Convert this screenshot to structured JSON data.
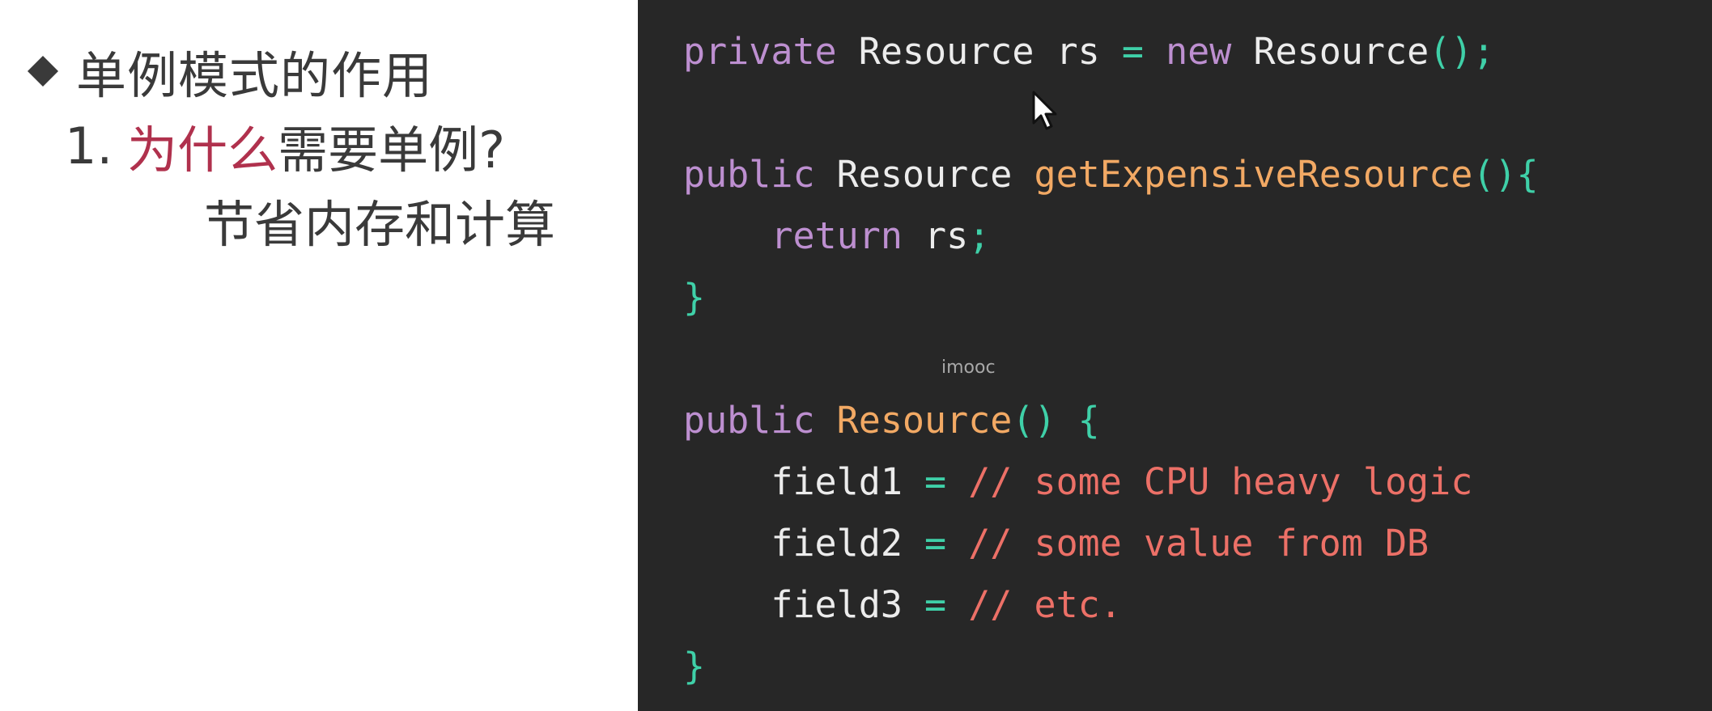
{
  "slide": {
    "heading": "单例模式的作用",
    "question": {
      "number": "1.",
      "highlight": "为什么",
      "rest": "需要单例?"
    },
    "answer": "节省内存和计算"
  },
  "code": {
    "lines": [
      [
        {
          "t": "kw",
          "v": "private "
        },
        {
          "t": "type",
          "v": "Resource "
        },
        {
          "t": "id",
          "v": "rs "
        },
        {
          "t": "op",
          "v": "= "
        },
        {
          "t": "kw",
          "v": "new "
        },
        {
          "t": "type",
          "v": "Resource"
        },
        {
          "t": "op",
          "v": "();"
        }
      ],
      [],
      [
        {
          "t": "kw",
          "v": "public "
        },
        {
          "t": "type",
          "v": "Resource "
        },
        {
          "t": "fn",
          "v": "getExpensiveResource"
        },
        {
          "t": "op",
          "v": "(){"
        }
      ],
      [
        {
          "t": "kw",
          "v": "    return "
        },
        {
          "t": "id",
          "v": "rs"
        },
        {
          "t": "op",
          "v": ";"
        }
      ],
      [
        {
          "t": "op",
          "v": "}"
        }
      ],
      [],
      [
        {
          "t": "kw",
          "v": "public "
        },
        {
          "t": "fn",
          "v": "Resource"
        },
        {
          "t": "op",
          "v": "() {"
        }
      ],
      [
        {
          "t": "id",
          "v": "    field1 "
        },
        {
          "t": "op",
          "v": "= "
        },
        {
          "t": "cm",
          "v": "// some CPU heavy logic"
        }
      ],
      [
        {
          "t": "id",
          "v": "    field2 "
        },
        {
          "t": "op",
          "v": "= "
        },
        {
          "t": "cm",
          "v": "// some value from DB"
        }
      ],
      [
        {
          "t": "id",
          "v": "    field3 "
        },
        {
          "t": "op",
          "v": "= "
        },
        {
          "t": "cm",
          "v": "// etc."
        }
      ],
      [
        {
          "t": "op",
          "v": "}"
        }
      ]
    ],
    "colors": {
      "background": "#272727",
      "keyword": "#bd8fd0",
      "type": "#ececec",
      "operator": "#3fd0a8",
      "function": "#f2a964",
      "comment": "#ec7067"
    }
  },
  "watermark": "imooc",
  "icons": {
    "bullet": "diamond-bullet-icon",
    "pointer": "mouse-cursor-icon"
  }
}
